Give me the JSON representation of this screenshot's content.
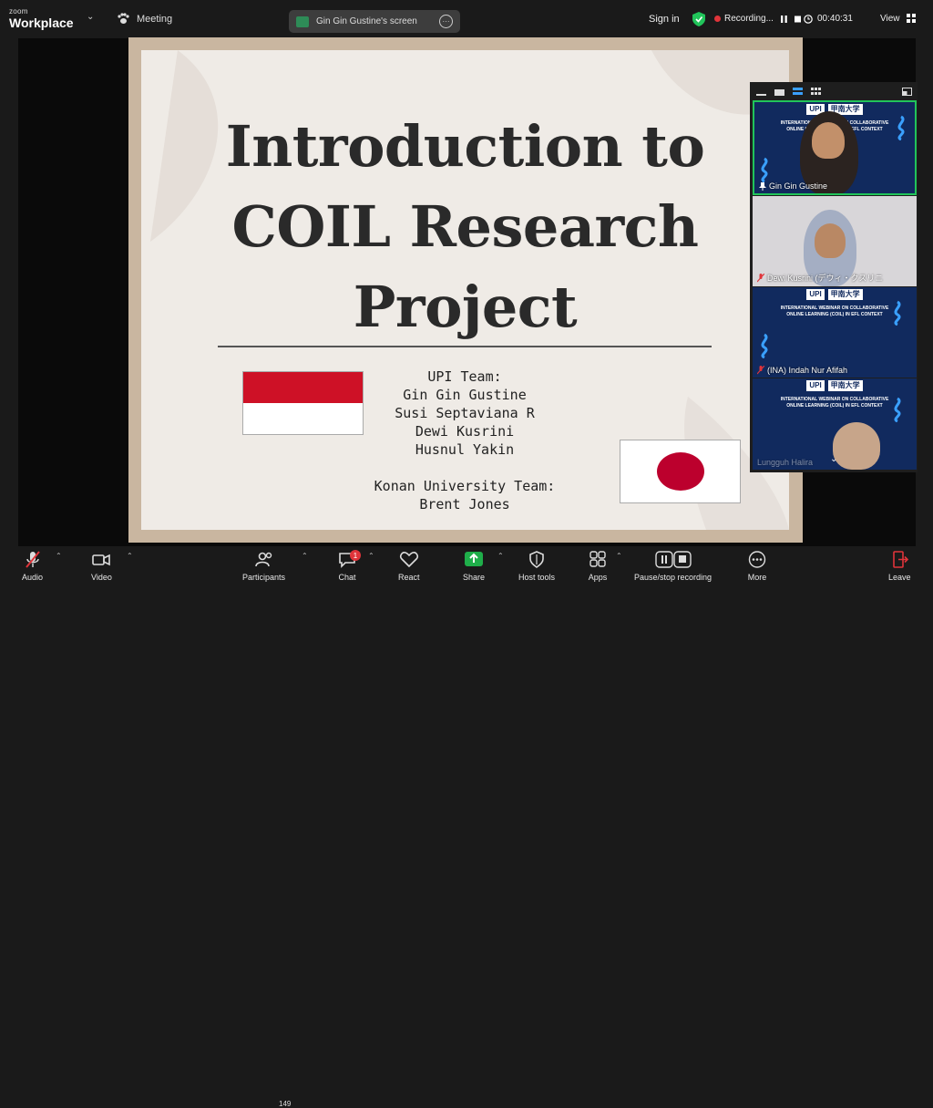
{
  "app": {
    "logo_small": "zoom",
    "logo_big": "Workplace",
    "meeting_label": "Meeting",
    "screen_share_label": "Gin Gin Gustine's screen",
    "sign_in": "Sign in",
    "recording_label": "Recording...",
    "timer": "00:40:31",
    "view_label": "View"
  },
  "slide": {
    "title_line1": "Introduction to",
    "title_line2": "COIL Research",
    "title_line3": "Project",
    "team_lines": [
      "UPI Team:",
      "Gin Gin Gustine",
      "Susi Septaviana R",
      "Dewi Kusrini",
      "Husnul Yakin",
      "",
      "Konan University Team:",
      "Brent Jones"
    ]
  },
  "panel": {
    "tiles": [
      {
        "name": "Gin Gin Gustine",
        "type": "webinar",
        "active": true
      },
      {
        "name": "Dewi Kusrini (デウィ・クスリニ",
        "type": "camera"
      },
      {
        "name": "(INA) Indah Nur Afifah",
        "type": "webinar"
      },
      {
        "name": "Lungguh Halira",
        "type": "webinar"
      }
    ],
    "webinar_logo_left": "UPI",
    "webinar_logo_right": "甲南大学",
    "webinar_title_line1": "INTERNATIONAL WEBINAR ON COLLABORATIVE",
    "webinar_title_line2": "ONLINE LEARNING (COIL) IN EFL CONTEXT"
  },
  "toolbar": {
    "audio": "Audio",
    "video": "Video",
    "participants": "Participants",
    "participants_count": "149",
    "chat": "Chat",
    "chat_badge": "1",
    "react": "React",
    "share": "Share",
    "host_tools": "Host tools",
    "apps": "Apps",
    "pause_recording": "Pause/stop recording",
    "more": "More",
    "leave": "Leave"
  },
  "colors": {
    "accent_green": "#21c45a",
    "record_red": "#e0343a",
    "share_green": "#1fae4a"
  }
}
